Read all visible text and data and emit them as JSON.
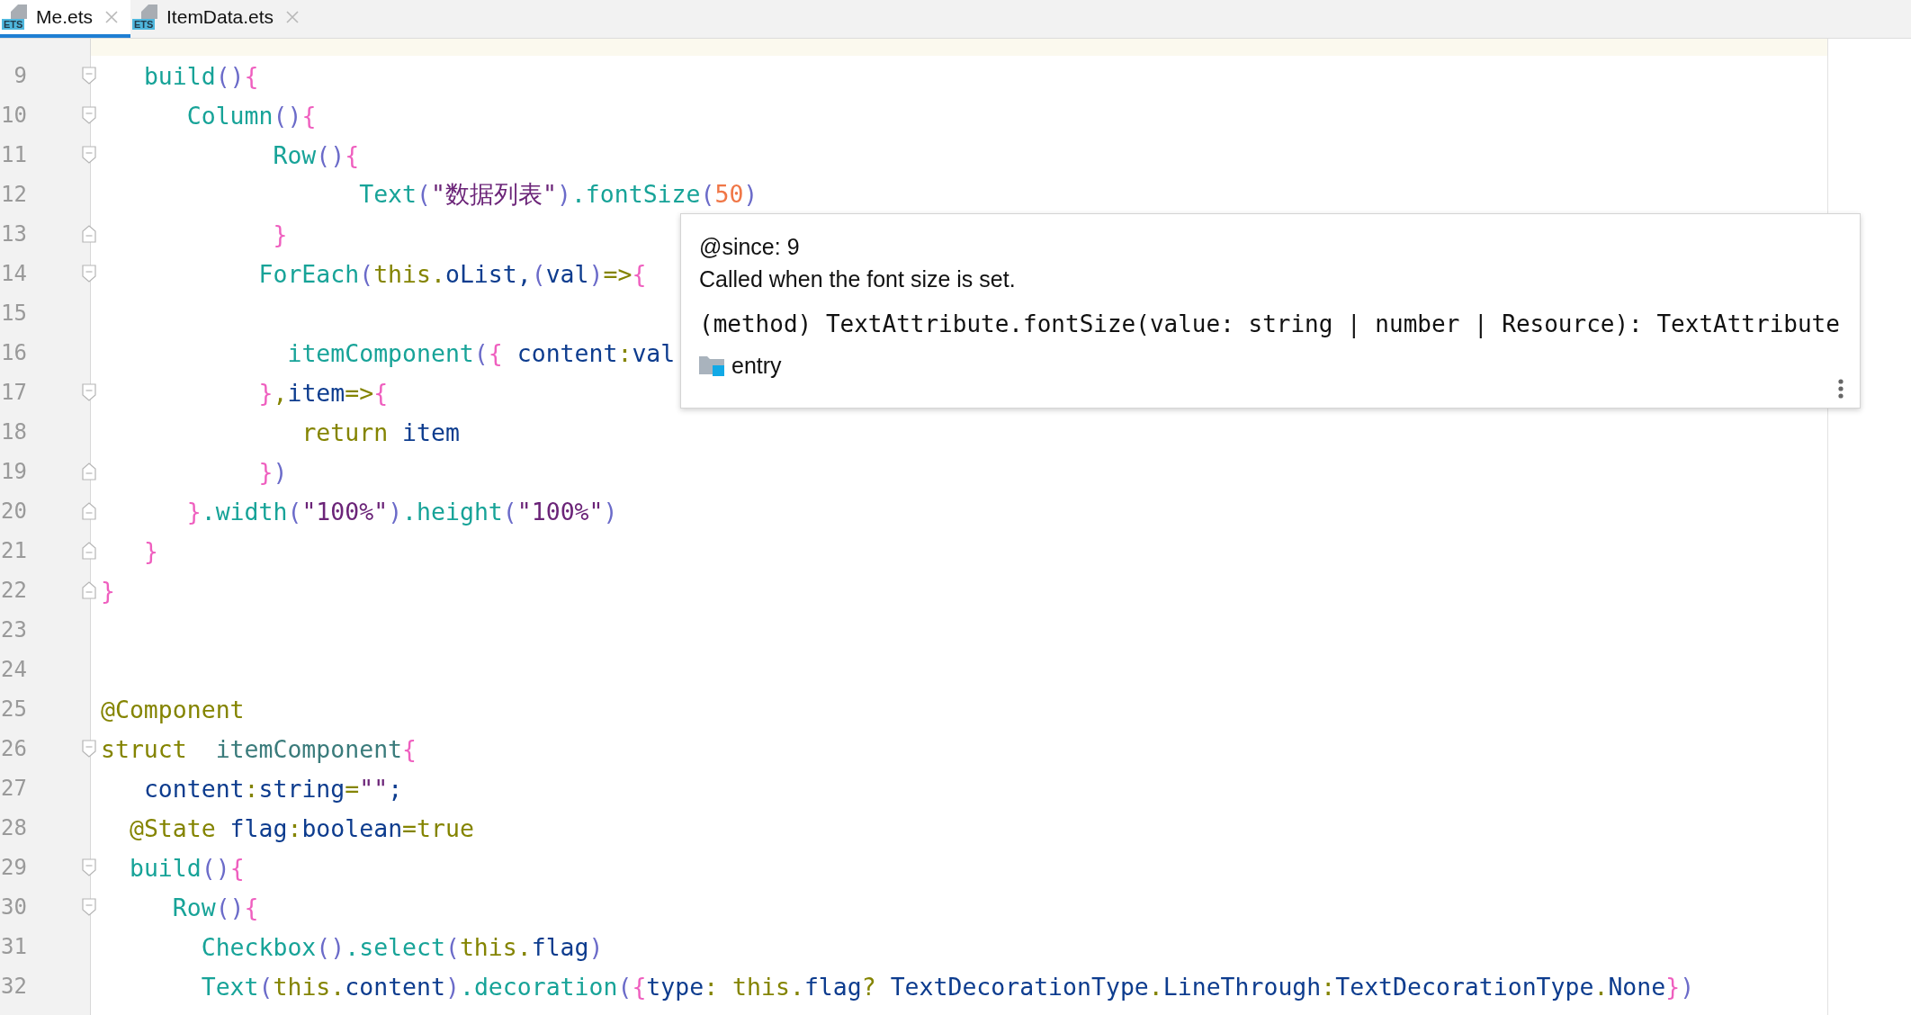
{
  "tabs": [
    {
      "label": "Me.ets",
      "badge": "ETS",
      "selected": true
    },
    {
      "label": "ItemData.ets",
      "badge": "ETS",
      "selected": false
    }
  ],
  "editor": {
    "lines": [
      {
        "number": "9",
        "kind": "open",
        "tokens": [
          {
            "text": "   build",
            "kind": "fn"
          },
          {
            "text": "()",
            "kind": "paren"
          },
          {
            "text": "{",
            "kind": "brace"
          }
        ]
      },
      {
        "number": "10",
        "kind": "open",
        "tokens": [
          {
            "text": "      Column",
            "kind": "fn"
          },
          {
            "text": "()",
            "kind": "paren"
          },
          {
            "text": "{",
            "kind": "brace"
          }
        ]
      },
      {
        "number": "11",
        "kind": "open",
        "tokens": [
          {
            "text": "            Row",
            "kind": "fn"
          },
          {
            "text": "()",
            "kind": "paren"
          },
          {
            "text": "{",
            "kind": "brace"
          }
        ]
      },
      {
        "number": "12",
        "kind": "plain",
        "tokens": [
          {
            "text": "                  Text",
            "kind": "fn"
          },
          {
            "text": "(",
            "kind": "paren"
          },
          {
            "text": "\"数据列表\"",
            "kind": "str"
          },
          {
            "text": ")",
            "kind": "paren"
          },
          {
            "text": ".fontSize",
            "kind": "fn"
          },
          {
            "text": "(",
            "kind": "paren"
          },
          {
            "text": "50",
            "kind": "num"
          },
          {
            "text": ")",
            "kind": "paren"
          }
        ]
      },
      {
        "number": "13",
        "kind": "close",
        "tokens": [
          {
            "text": "            }",
            "kind": "brace"
          }
        ]
      },
      {
        "number": "14",
        "kind": "open",
        "tokens": [
          {
            "text": "           ForEach",
            "kind": "fn"
          },
          {
            "text": "(",
            "kind": "paren"
          },
          {
            "text": "this.",
            "kind": "kw"
          },
          {
            "text": "oList,",
            "kind": "id"
          },
          {
            "text": "(",
            "kind": "paren"
          },
          {
            "text": "val",
            "kind": "id"
          },
          {
            "text": ")",
            "kind": "paren"
          },
          {
            "text": "=>",
            "kind": "kw"
          },
          {
            "text": "{",
            "kind": "brace"
          }
        ]
      },
      {
        "number": "15",
        "kind": "plain"
      },
      {
        "number": "16",
        "kind": "plain",
        "tokens": [
          {
            "text": "             itemComponent",
            "kind": "fn"
          },
          {
            "text": "(",
            "kind": "paren"
          },
          {
            "text": "{",
            "kind": "brace"
          },
          {
            "text": " content",
            "kind": "id"
          },
          {
            "text": ":",
            "kind": "kw"
          },
          {
            "text": "val",
            "kind": "id"
          }
        ]
      },
      {
        "number": "17",
        "kind": "open",
        "tokens": [
          {
            "text": "           }",
            "kind": "brace"
          },
          {
            "text": ",",
            "kind": "kw"
          },
          {
            "text": "item",
            "kind": "id"
          },
          {
            "text": "=>",
            "kind": "kw"
          },
          {
            "text": "{",
            "kind": "brace"
          }
        ]
      },
      {
        "number": "18",
        "kind": "plain",
        "tokens": [
          {
            "text": "              return",
            "kind": "kw"
          },
          {
            "text": " item",
            "kind": "id"
          }
        ]
      },
      {
        "number": "19",
        "kind": "close",
        "tokens": [
          {
            "text": "           }",
            "kind": "brace"
          },
          {
            "text": ")",
            "kind": "paren"
          }
        ]
      },
      {
        "number": "20",
        "kind": "close",
        "tokens": [
          {
            "text": "      }",
            "kind": "brace"
          },
          {
            "text": ".width",
            "kind": "fn"
          },
          {
            "text": "(",
            "kind": "paren"
          },
          {
            "text": "\"100%\"",
            "kind": "str"
          },
          {
            "text": ")",
            "kind": "paren"
          },
          {
            "text": ".height",
            "kind": "fn"
          },
          {
            "text": "(",
            "kind": "paren"
          },
          {
            "text": "\"100%\"",
            "kind": "str"
          },
          {
            "text": ")",
            "kind": "paren"
          }
        ]
      },
      {
        "number": "21",
        "kind": "close",
        "tokens": [
          {
            "text": "   }",
            "kind": "brace"
          }
        ]
      },
      {
        "number": "22",
        "kind": "close",
        "tokens": [
          {
            "text": "}",
            "kind": "brace"
          }
        ]
      },
      {
        "number": "23",
        "kind": "plain"
      },
      {
        "number": "24",
        "kind": "plain"
      },
      {
        "number": "25",
        "kind": "plain",
        "tokens": [
          {
            "text": "@Component",
            "kind": "kw"
          }
        ]
      },
      {
        "number": "26",
        "kind": "open",
        "tokens": [
          {
            "text": "struct",
            "kind": "kw"
          },
          {
            "text": "  itemComponent",
            "kind": "type"
          },
          {
            "text": "{",
            "kind": "brace"
          }
        ]
      },
      {
        "number": "27",
        "kind": "plain",
        "tokens": [
          {
            "text": "   content",
            "kind": "id"
          },
          {
            "text": ":",
            "kind": "kw"
          },
          {
            "text": "string",
            "kind": "id"
          },
          {
            "text": "=",
            "kind": "kw"
          },
          {
            "text": "\"\"",
            "kind": "str"
          },
          {
            "text": ";",
            "kind": "id"
          }
        ]
      },
      {
        "number": "28",
        "kind": "plain",
        "tokens": [
          {
            "text": "  @State",
            "kind": "kw"
          },
          {
            "text": " flag",
            "kind": "id"
          },
          {
            "text": ":",
            "kind": "kw"
          },
          {
            "text": "boolean",
            "kind": "id"
          },
          {
            "text": "=true",
            "kind": "kw"
          }
        ]
      },
      {
        "number": "29",
        "kind": "open",
        "tokens": [
          {
            "text": "  build",
            "kind": "fn"
          },
          {
            "text": "()",
            "kind": "paren"
          },
          {
            "text": "{",
            "kind": "brace"
          }
        ]
      },
      {
        "number": "30",
        "kind": "open",
        "tokens": [
          {
            "text": "     Row",
            "kind": "fn"
          },
          {
            "text": "()",
            "kind": "paren"
          },
          {
            "text": "{",
            "kind": "brace"
          }
        ]
      },
      {
        "number": "31",
        "kind": "plain",
        "tokens": [
          {
            "text": "       Checkbox",
            "kind": "fn"
          },
          {
            "text": "()",
            "kind": "paren"
          },
          {
            "text": ".select",
            "kind": "fn"
          },
          {
            "text": "(",
            "kind": "paren"
          },
          {
            "text": "this.",
            "kind": "kw"
          },
          {
            "text": "flag",
            "kind": "id"
          },
          {
            "text": ")",
            "kind": "paren"
          }
        ]
      },
      {
        "number": "32",
        "kind": "plain",
        "tokens": [
          {
            "text": "       Text",
            "kind": "fn"
          },
          {
            "text": "(",
            "kind": "paren"
          },
          {
            "text": "this.",
            "kind": "kw"
          },
          {
            "text": "content",
            "kind": "id"
          },
          {
            "text": ")",
            "kind": "paren"
          },
          {
            "text": ".decoration",
            "kind": "fn"
          },
          {
            "text": "(",
            "kind": "paren"
          },
          {
            "text": "{",
            "kind": "brace"
          },
          {
            "text": "type",
            "kind": "id"
          },
          {
            "text": ": this.",
            "kind": "kw"
          },
          {
            "text": "flag",
            "kind": "id"
          },
          {
            "text": "? ",
            "kind": "kw"
          },
          {
            "text": "TextDecorationType",
            "kind": "id"
          },
          {
            "text": ".",
            "kind": "kw"
          },
          {
            "text": "LineThrough",
            "kind": "id"
          },
          {
            "text": ":",
            "kind": "kw"
          },
          {
            "text": "TextDecorationType",
            "kind": "id"
          },
          {
            "text": ".",
            "kind": "kw"
          },
          {
            "text": "None",
            "kind": "id"
          },
          {
            "text": "}",
            "kind": "brace"
          },
          {
            "text": ")",
            "kind": "paren"
          }
        ]
      }
    ]
  },
  "doc_popup": {
    "since": "@since: 9",
    "description": "Called when the font size is set.",
    "signature": "(method) TextAttribute.fontSize(value: string | number | Resource): TextAttribute",
    "module": "entry"
  }
}
